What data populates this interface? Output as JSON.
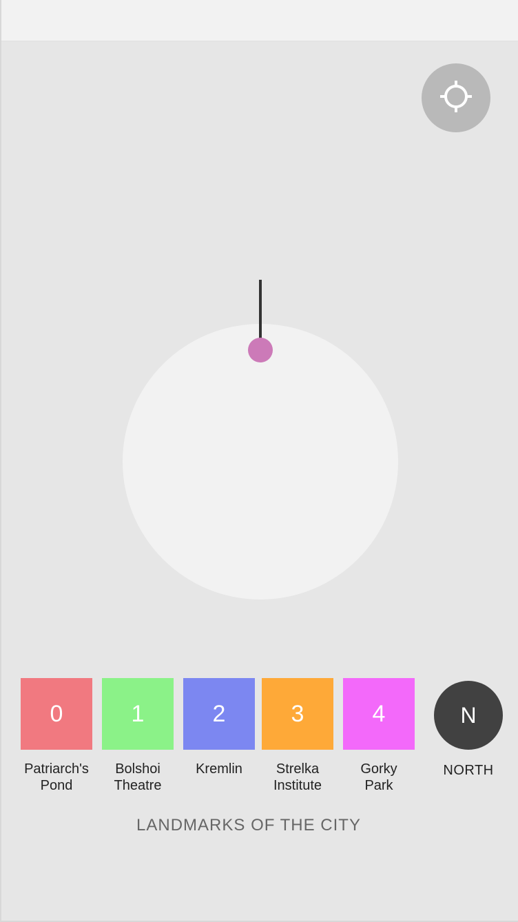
{
  "compass": {
    "north_label": "N",
    "north_caption": "NORTH",
    "heading_deg": 0,
    "indicator_color": "#cc7ab8"
  },
  "locate": {
    "icon": "crosshair-icon"
  },
  "landmarks": {
    "title": "LANDMARKS OF THE CITY",
    "items": [
      {
        "index": "0",
        "label": "Patriarch's\nPond",
        "color": "#f17980"
      },
      {
        "index": "1",
        "label": "Bolshoi\nTheatre",
        "color": "#8bf288"
      },
      {
        "index": "2",
        "label": "Kremlin",
        "color": "#7c87f1"
      },
      {
        "index": "3",
        "label": "Strelka\nInstitute",
        "color": "#fea938"
      },
      {
        "index": "4",
        "label": "Gorky\nPark",
        "color": "#f369fa"
      }
    ]
  }
}
